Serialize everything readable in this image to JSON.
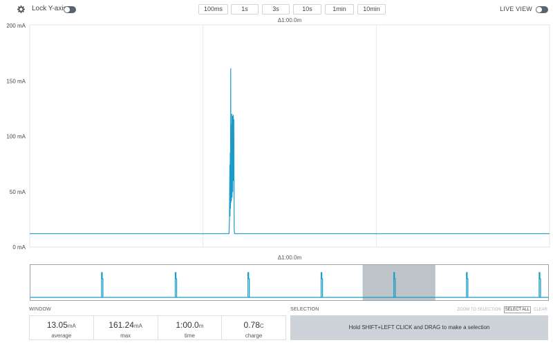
{
  "toolbar": {
    "lock_y_label": "Lock Y-axis",
    "lock_y_on": false,
    "windows": [
      "100ms",
      "1s",
      "3s",
      "10s",
      "1min",
      "10min"
    ],
    "live_view_label": "LIVE VIEW",
    "live_view_on": false
  },
  "main": {
    "delta_label": "Δ1:00.0m",
    "trace_color": "#1a9cc8"
  },
  "chart_data": {
    "type": "line",
    "x_unit": "s",
    "xlim": [
      0,
      60
    ],
    "ylim": [
      0,
      200
    ],
    "y_ticks": [
      "200 mA",
      "150 mA",
      "100 mA",
      "50 mA",
      "0 mA"
    ],
    "grid": true,
    "baseline_mA": 12,
    "series": [
      {
        "values": [
          [
            0,
            12
          ],
          [
            23.0,
            12
          ],
          [
            23.05,
            24
          ],
          [
            23.1,
            74
          ],
          [
            23.12,
            28
          ],
          [
            23.15,
            85
          ],
          [
            23.17,
            35
          ],
          [
            23.2,
            161
          ],
          [
            23.22,
            40
          ],
          [
            23.25,
            110
          ],
          [
            23.28,
            42
          ],
          [
            23.3,
            58
          ],
          [
            23.33,
            120
          ],
          [
            23.36,
            45
          ],
          [
            23.4,
            118
          ],
          [
            23.43,
            50
          ],
          [
            23.46,
            95
          ],
          [
            23.5,
            119
          ],
          [
            23.53,
            60
          ],
          [
            23.56,
            115
          ],
          [
            23.6,
            16
          ],
          [
            23.65,
            12
          ],
          [
            60,
            12
          ]
        ]
      }
    ]
  },
  "overview": {
    "delta_label": "Δ1:00.0m",
    "spike_positions": [
      0.137,
      0.279,
      0.419,
      0.56,
      0.7,
      0.84,
      0.98
    ],
    "selection_range": [
      0.64,
      0.78
    ]
  },
  "window": {
    "title": "WINDOW",
    "stats": [
      {
        "value": "13.05",
        "unit": "mA",
        "label": "average"
      },
      {
        "value": "161.24",
        "unit": "mA",
        "label": "max"
      },
      {
        "value": "1:00.0",
        "unit": "m",
        "label": "time"
      },
      {
        "value": "0.78",
        "unit": "C",
        "label": "charge"
      }
    ]
  },
  "selection": {
    "title": "SELECTION",
    "actions": [
      {
        "label": "ZOOM TO SELECTION",
        "active": false
      },
      {
        "label": "SELECT ALL",
        "active": true
      },
      {
        "label": "CLEAR",
        "active": false
      }
    ],
    "hint": "Hold SHIFT+LEFT CLICK and DRAG to make a selection"
  }
}
